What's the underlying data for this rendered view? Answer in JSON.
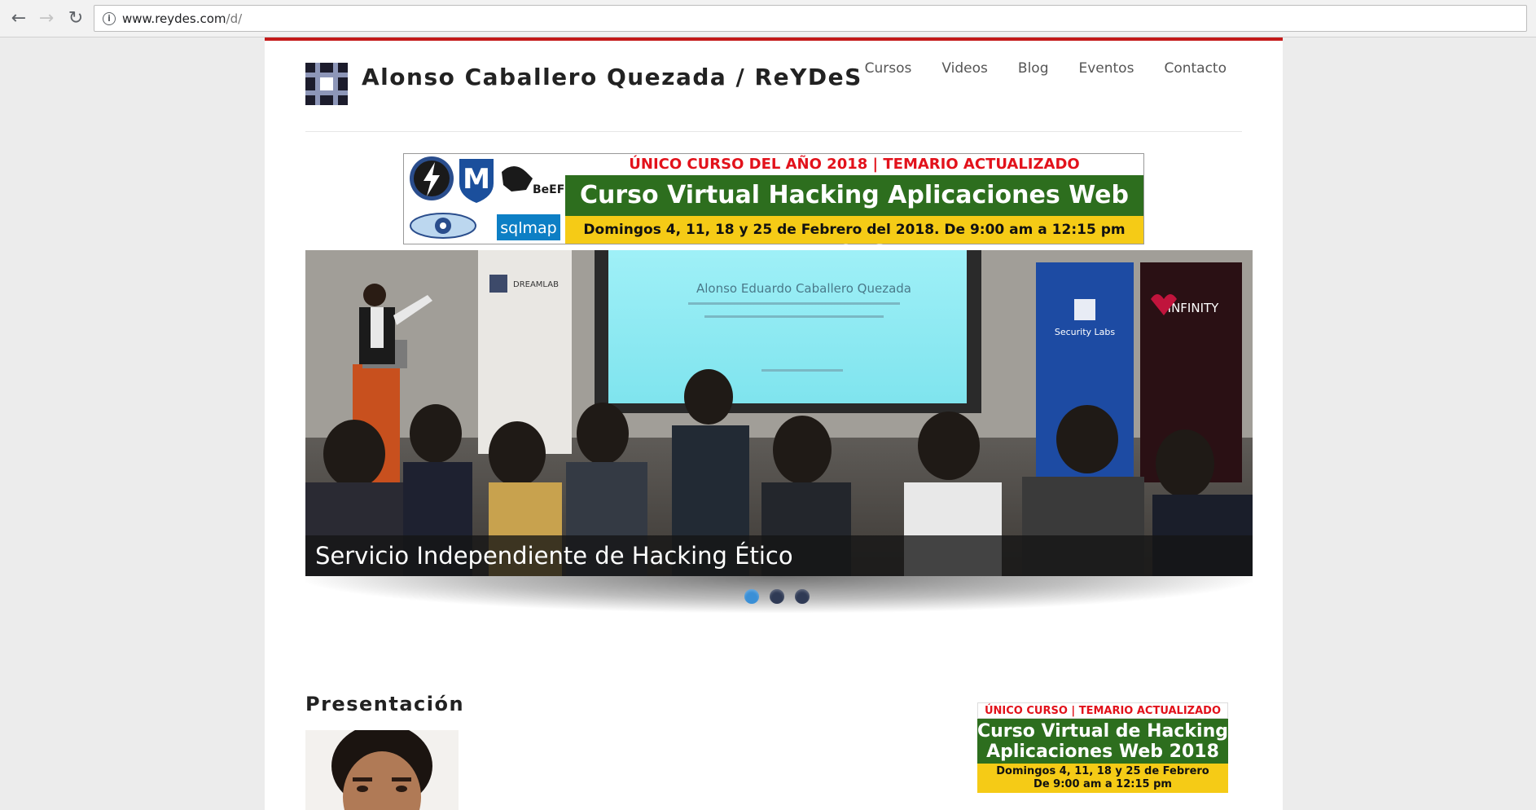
{
  "browser": {
    "url_host": "www.reydes.com",
    "url_path": "/d/"
  },
  "site": {
    "title": "Alonso Caballero Quezada / ReYDeS",
    "menu": [
      "Cursos",
      "Videos",
      "Blog",
      "Eventos",
      "Contacto"
    ]
  },
  "banner": {
    "top": "ÚNICO CURSO DEL AÑO 2018 | TEMARIO ACTUALIZADO",
    "main": "Curso Virtual Hacking Aplicaciones Web 2018",
    "bottom": "Domingos 4, 11, 18 y 25 de Febrero del 2018. De 9:00 am a 12:15 pm",
    "icon_labels": {
      "beef": "BeEF",
      "sqlmap": "sqlmap"
    }
  },
  "slider": {
    "caption": "Servicio Independiente de Hacking Ético",
    "screen_text": "Alonso Eduardo Caballero Quezada",
    "sponsor_left": "DREAMLAB",
    "sponsor_mid": "Security Labs",
    "sponsor_right": "INFINITY",
    "dots": 3,
    "active_dot": 1
  },
  "section": {
    "heading": "Presentación"
  },
  "side_banner": {
    "top": "ÚNICO CURSO | TEMARIO ACTUALIZADO",
    "main_line1": "Curso Virtual de Hacking",
    "main_line2": "Aplicaciones Web 2018",
    "bottom_line1": "Domingos 4, 11, 18 y 25 de Febrero",
    "bottom_line2": "De 9:00 am a 12:15 pm"
  },
  "colors": {
    "accent_red": "#c41a1a",
    "banner_green": "#2d6e1e",
    "banner_yellow": "#f5cb16",
    "banner_red_text": "#e2121b"
  }
}
